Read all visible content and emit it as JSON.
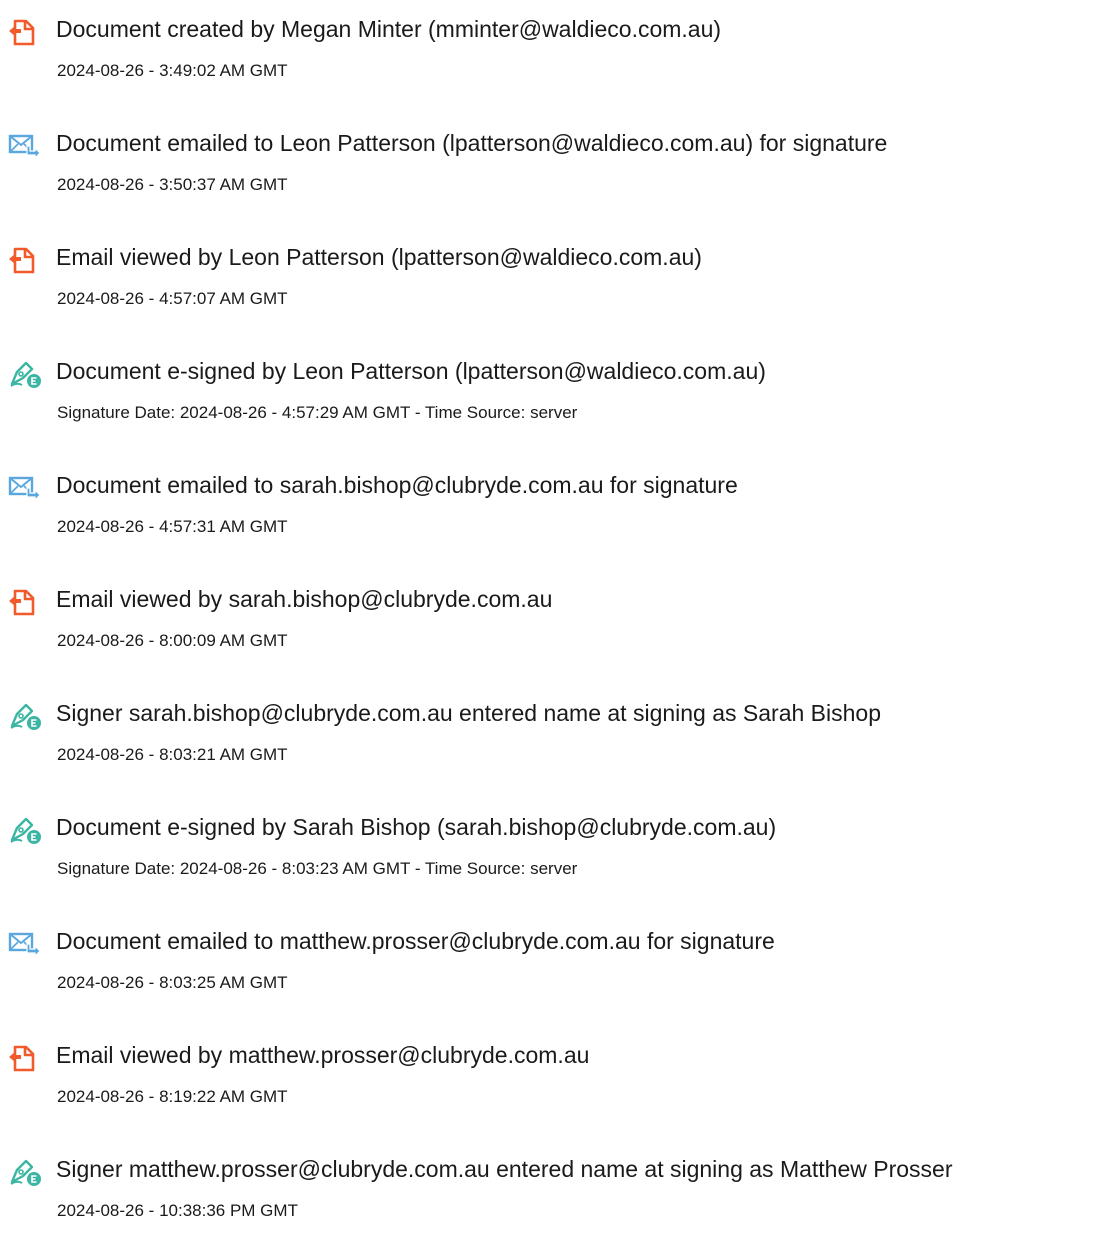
{
  "colors": {
    "doc_icon": "#f15a2b",
    "mail_icon": "#5aa7e0",
    "sign_icon": "#3cb6a3",
    "text": "#1a1a1a"
  },
  "entries": [
    {
      "icon": "document-icon",
      "title": "Document created by Megan Minter (mminter@waldieco.com.au)",
      "detail": "2024-08-26 - 3:49:02 AM GMT"
    },
    {
      "icon": "email-icon",
      "title": "Document emailed to Leon Patterson (lpatterson@waldieco.com.au) for signature",
      "detail": "2024-08-26 - 3:50:37 AM GMT"
    },
    {
      "icon": "document-icon",
      "title": "Email viewed by Leon Patterson (lpatterson@waldieco.com.au)",
      "detail": "2024-08-26 - 4:57:07 AM GMT"
    },
    {
      "icon": "e-sign-icon",
      "title": "Document e-signed by Leon Patterson (lpatterson@waldieco.com.au)",
      "detail": "Signature Date: 2024-08-26 - 4:57:29 AM GMT - Time Source: server"
    },
    {
      "icon": "email-icon",
      "title": "Document emailed to sarah.bishop@clubryde.com.au for signature",
      "detail": "2024-08-26 - 4:57:31 AM GMT"
    },
    {
      "icon": "document-icon",
      "title": "Email viewed by sarah.bishop@clubryde.com.au",
      "detail": "2024-08-26 - 8:00:09 AM GMT"
    },
    {
      "icon": "e-sign-icon",
      "title": "Signer sarah.bishop@clubryde.com.au entered name at signing as Sarah Bishop",
      "detail": "2024-08-26 - 8:03:21 AM GMT"
    },
    {
      "icon": "e-sign-icon",
      "title": "Document e-signed by Sarah Bishop (sarah.bishop@clubryde.com.au)",
      "detail": "Signature Date: 2024-08-26 - 8:03:23 AM GMT - Time Source: server"
    },
    {
      "icon": "email-icon",
      "title": "Document emailed to matthew.prosser@clubryde.com.au for signature",
      "detail": "2024-08-26 - 8:03:25 AM GMT"
    },
    {
      "icon": "document-icon",
      "title": "Email viewed by matthew.prosser@clubryde.com.au",
      "detail": "2024-08-26 - 8:19:22 AM GMT"
    },
    {
      "icon": "e-sign-icon",
      "title": "Signer matthew.prosser@clubryde.com.au entered name at signing as Matthew Prosser",
      "detail": "2024-08-26 - 10:38:36 PM GMT"
    }
  ]
}
